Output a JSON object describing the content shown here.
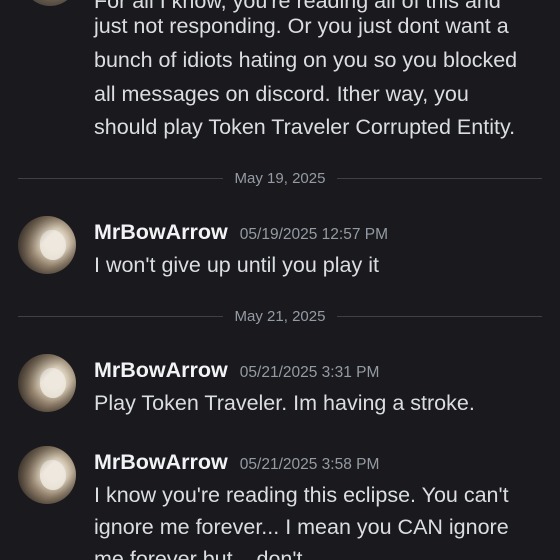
{
  "previous_message": {
    "lines": [
      "For all I know, you're reading all of this and",
      "just not responding. Or you just dont want a",
      "bunch of idiots hating on you so you blocked",
      "all messages on discord. Ither way, you",
      "should play Token Traveler Corrupted Entity."
    ]
  },
  "dividers": [
    {
      "date": "May 19, 2025"
    },
    {
      "date": "May 21, 2025"
    }
  ],
  "messages": [
    {
      "username": "MrBowArrow",
      "timestamp": "05/19/2025 12:57 PM",
      "lines": [
        "I won't give up until you play it"
      ]
    },
    {
      "username": "MrBowArrow",
      "timestamp": "05/21/2025 3:31 PM",
      "lines": [
        "Play Token Traveler. Im having a stroke."
      ]
    },
    {
      "username": "MrBowArrow",
      "timestamp": "05/21/2025 3:58 PM",
      "lines": [
        "I know you're reading this eclipse. You can't",
        "ignore me forever... I mean you CAN ignore",
        "me forever but... don't."
      ]
    }
  ],
  "colors": {
    "background": "#1a1a1e",
    "text": "#dbdee1",
    "username": "#f2f3f5",
    "muted": "#949ba4",
    "divider_line": "#3f4147"
  },
  "icons": {
    "avatar": "user-avatar-icon"
  }
}
